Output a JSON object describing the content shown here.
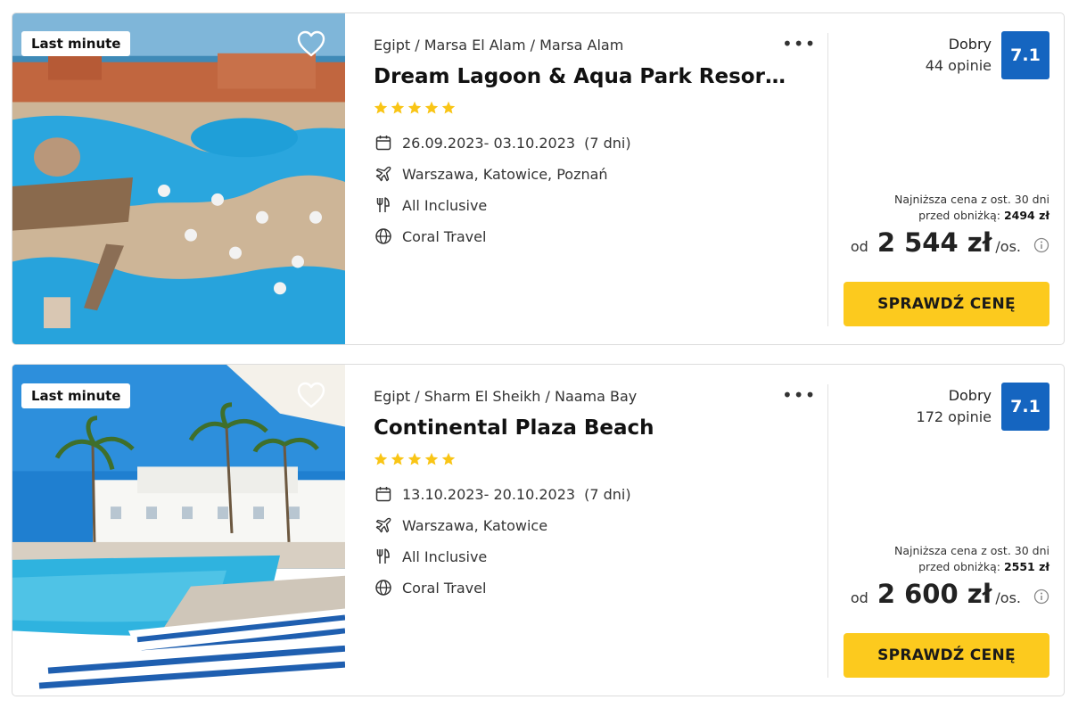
{
  "offers": [
    {
      "badge": "Last minute",
      "breadcrumb": "Egipt / Marsa El Alam / Marsa Alam",
      "title": "Dream Lagoon & Aqua Park Resort (…",
      "stars": 5,
      "dates": "26.09.2023- 03.10.2023",
      "nights": "(7 dni)",
      "departures": "Warszawa, Katowice, Poznań",
      "board": "All Inclusive",
      "operator": "Coral Travel",
      "rating_word": "Dobry",
      "reviews": "44 opinie",
      "score": "7.1",
      "lowest_line1": "Najniższa cena z ost. 30 dni",
      "lowest_prefix": "przed obniżką:",
      "lowest_value": "2494 zł",
      "price_prefix": "od",
      "price": "2 544 zł",
      "price_suffix": "/os.",
      "cta": "SPRAWDŹ CENĘ"
    },
    {
      "badge": "Last minute",
      "breadcrumb": "Egipt / Sharm El Sheikh / Naama Bay",
      "title": "Continental Plaza Beach",
      "stars": 5,
      "dates": "13.10.2023- 20.10.2023",
      "nights": "(7 dni)",
      "departures": "Warszawa, Katowice",
      "board": "All Inclusive",
      "operator": "Coral Travel",
      "rating_word": "Dobry",
      "reviews": "172 opinie",
      "score": "7.1",
      "lowest_line1": "Najniższa cena z ost. 30 dni",
      "lowest_prefix": "przed obniżką:",
      "lowest_value": "2551 zł",
      "price_prefix": "od",
      "price": "2 600 zł",
      "price_suffix": "/os.",
      "cta": "SPRAWDŹ CENĘ"
    }
  ],
  "icons": {
    "favorite": "heart-outline-icon",
    "more": "more-horizontal-icon",
    "star": "star-icon",
    "calendar": "calendar-icon",
    "departure": "plane-icon",
    "board": "cutlery-icon",
    "operator": "globe-icon",
    "info": "info-circle-icon"
  },
  "colors": {
    "accent_button": "#fcca1e",
    "score_badge": "#1565c0",
    "star": "#f9c516"
  }
}
